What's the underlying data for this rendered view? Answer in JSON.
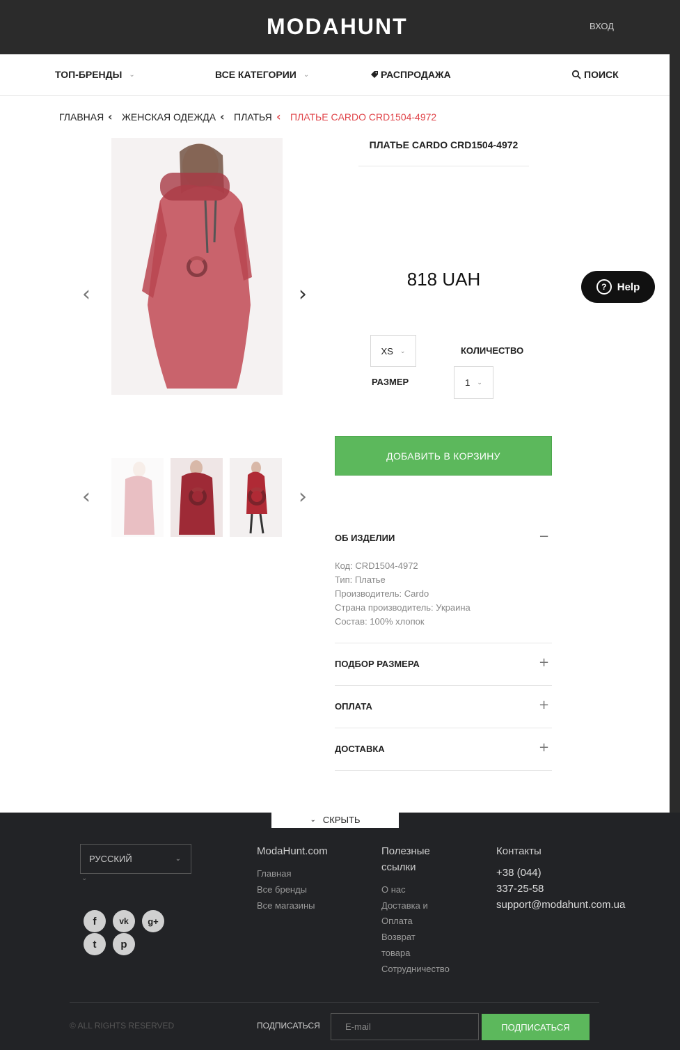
{
  "header": {
    "logo": "MODAHUNT",
    "login": "ВХОД"
  },
  "nav": {
    "top_brands": "ТОП-БРЕНДЫ",
    "all_categories": "ВСЕ КАТЕГОРИИ",
    "sale": "РАСПРОДАЖА",
    "search": "ПОИСК"
  },
  "breadcrumb": {
    "items": [
      "ГЛАВНАЯ",
      "ЖЕНСКАЯ ОДЕЖДА",
      "ПЛАТЬЯ"
    ],
    "current": "ПЛАТЬЕ CARDO CRD1504-4972",
    "current_color": "#e0454a"
  },
  "product": {
    "title": "ПЛАТЬЕ CARDO CRD1504-4972",
    "price": "818 UAH",
    "size_value": "XS",
    "size_label": "РАЗМЕР",
    "qty_label": "КОЛИЧЕСТВО",
    "qty_value": "1",
    "add_to_cart": "ДОБАВИТЬ В КОРЗИНУ",
    "dress_color": "#b02a35"
  },
  "help": {
    "label": "Help"
  },
  "accordion": {
    "about": {
      "title": "ОБ ИЗДЕЛИИ",
      "sign": "−",
      "lines": [
        "Код: CRD1504-4972",
        "Тип: Платье",
        "Производитель: Cardo",
        "Страна производитель: Украина",
        "Состав: 100% хлопок"
      ]
    },
    "size": {
      "title": "ПОДБОР РАЗМЕРА",
      "sign": "+"
    },
    "payment": {
      "title": "ОПЛАТА",
      "sign": "+"
    },
    "delivery": {
      "title": "ДОСТАВКА",
      "sign": "+"
    }
  },
  "footer": {
    "hide": "СКРЫТЬ",
    "language": "РУССКИЙ",
    "col1": {
      "title": "ModaHunt.com",
      "links": [
        "Главная",
        "Все бренды",
        "Все магазины"
      ]
    },
    "col2": {
      "title_line1": "Полезные",
      "title_line2": "ссылки",
      "links": [
        "О нас",
        "Доставка и",
        "Оплата",
        "Возврат",
        "товара",
        "Сотрудничество"
      ]
    },
    "col3": {
      "title": "Контакты",
      "phone1": "+38 (044)",
      "phone2": "337-25-58",
      "email": "support@modahunt.com.ua"
    },
    "social": {
      "facebook": "f",
      "vk": "vk",
      "google": "g+",
      "twitter": "t",
      "pinterest": "p"
    },
    "copyright": "© ALL RIGHTS RESERVED",
    "subscribe_label": "ПОДПИСАТЬСЯ",
    "email_placeholder": "E-mail",
    "subscribe_button": "ПОДПИСАТЬСЯ"
  }
}
